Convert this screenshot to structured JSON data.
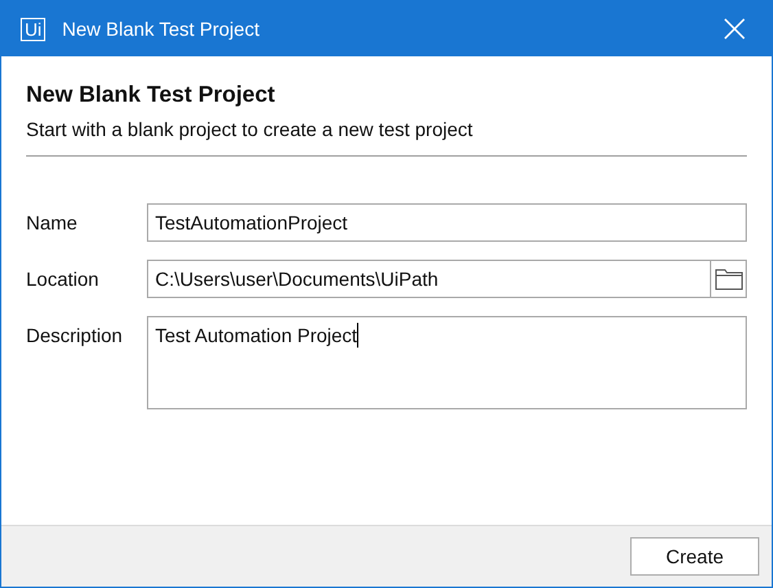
{
  "window": {
    "logo": "Ui",
    "title": "New Blank Test Project"
  },
  "header": {
    "title": "New Blank Test Project",
    "subtitle": "Start with a blank project to create a new test project"
  },
  "fields": [
    {
      "kind": "text",
      "label": "Name",
      "value": "TestAutomationProject",
      "focused": false
    },
    {
      "kind": "path",
      "label": "Location",
      "value": "C:\\Users\\user\\Documents\\UiPath",
      "focused": false
    },
    {
      "kind": "multiline",
      "label": "Description",
      "value": "Test Automation Project",
      "focused": true
    }
  ],
  "buttons": [
    "Create"
  ]
}
